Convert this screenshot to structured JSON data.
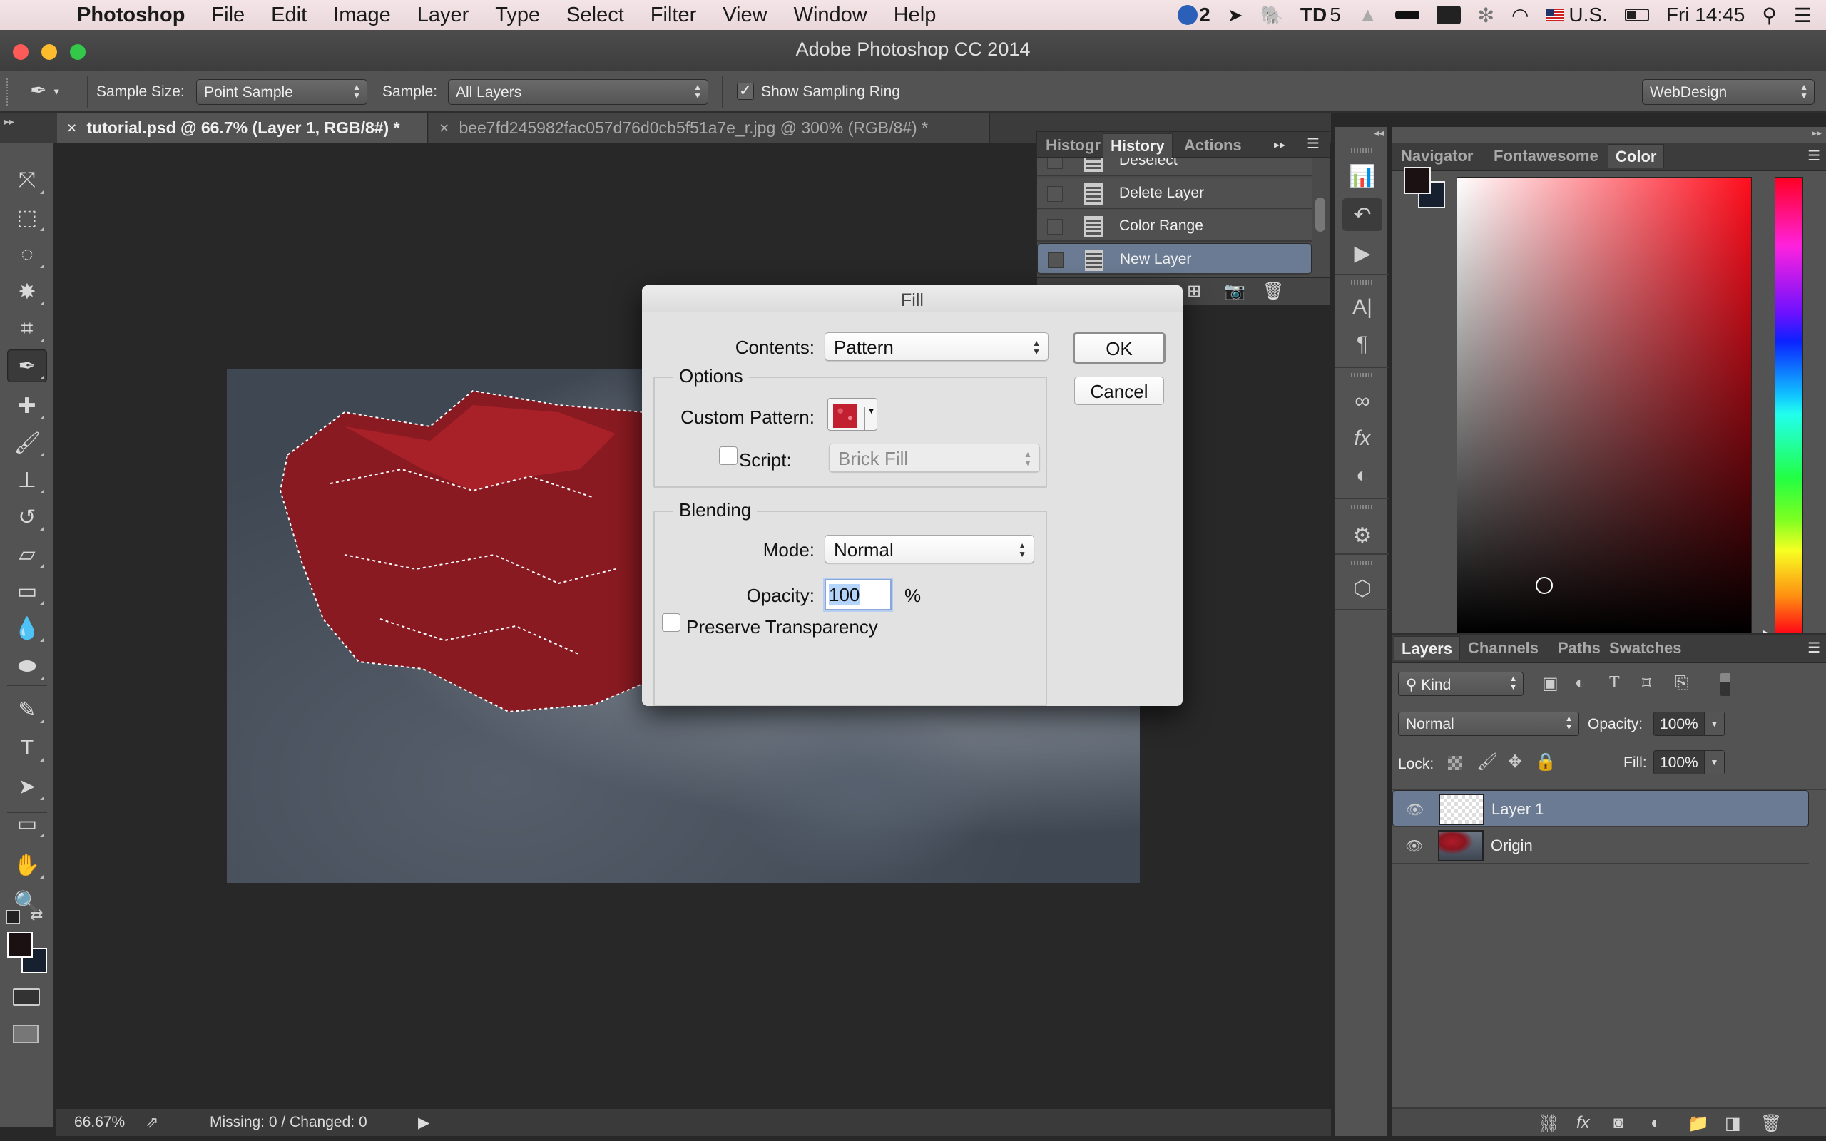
{
  "menubar": {
    "app_name": "Photoshop",
    "items": [
      "File",
      "Edit",
      "Image",
      "Layer",
      "Type",
      "Select",
      "Filter",
      "View",
      "Window",
      "Help"
    ],
    "status": {
      "cc_count": "2",
      "td_count": "5",
      "input_source": "U.S.",
      "clock": "Fri 14:45"
    }
  },
  "window": {
    "title": "Adobe Photoshop CC 2014"
  },
  "options_bar": {
    "sample_size_label": "Sample Size:",
    "sample_size_value": "Point Sample",
    "sample_label": "Sample:",
    "sample_value": "All Layers",
    "show_sampling_ring_label": "Show Sampling Ring",
    "show_sampling_ring_checked": true,
    "workspace": "WebDesign"
  },
  "doc_tabs": [
    {
      "label": "tutorial.psd @ 66.7% (Layer 1, RGB/8#) *",
      "active": true
    },
    {
      "label": "bee7fd245982fac057d76d0cb5f51a7e_r.jpg @ 300% (RGB/8#) *",
      "active": false
    }
  ],
  "toolbar": {
    "tools": [
      {
        "name": "move-tool",
        "glyph": "⤧"
      },
      {
        "name": "marquee-tool",
        "glyph": "⬚"
      },
      {
        "name": "lasso-tool",
        "glyph": "◌"
      },
      {
        "name": "magic-wand-tool",
        "glyph": "✸"
      },
      {
        "name": "crop-tool",
        "glyph": "⌗"
      },
      {
        "name": "eyedropper-tool",
        "glyph": "✒",
        "active": true
      },
      {
        "name": "healing-brush-tool",
        "glyph": "✚"
      },
      {
        "name": "brush-tool",
        "glyph": "🖌"
      },
      {
        "name": "clone-stamp-tool",
        "glyph": "⊥"
      },
      {
        "name": "history-brush-tool",
        "glyph": "↺"
      },
      {
        "name": "eraser-tool",
        "glyph": "▱"
      },
      {
        "name": "gradient-tool",
        "glyph": "▭"
      },
      {
        "name": "blur-tool",
        "glyph": "💧"
      },
      {
        "name": "sponge-tool",
        "glyph": "⬬"
      },
      {
        "name": "pen-tool",
        "glyph": "✎"
      },
      {
        "name": "type-tool",
        "glyph": "T"
      },
      {
        "name": "path-selection-tool",
        "glyph": "➤"
      },
      {
        "name": "rectangle-tool",
        "glyph": "▭"
      },
      {
        "name": "hand-tool",
        "glyph": "✋"
      },
      {
        "name": "zoom-tool",
        "glyph": "🔍"
      }
    ],
    "foreground_color": "#1b1012",
    "background_color": "#16202e"
  },
  "status_bar": {
    "zoom": "66.67%",
    "info": "Missing: 0 / Changed: 0"
  },
  "history_panel": {
    "tabs": [
      "Histogr",
      "History",
      "Actions"
    ],
    "active_tab": "History",
    "items": [
      {
        "label": "Deselect",
        "selected": false
      },
      {
        "label": "Delete Layer",
        "selected": false
      },
      {
        "label": "Color Range",
        "selected": false
      },
      {
        "label": "New Layer",
        "selected": true
      }
    ]
  },
  "color_panel": {
    "tabs": [
      "Navigator",
      "Fontawesome",
      "Color"
    ],
    "active_tab": "Color",
    "foreground": "#1b1012",
    "background": "#16202e",
    "hue_color": "#ff0d1c"
  },
  "layers_panel": {
    "tabs": [
      "Layers",
      "Channels",
      "Paths",
      "Swatches"
    ],
    "active_tab": "Layers",
    "filter_kind": "Kind",
    "blend_mode": "Normal",
    "opacity_label": "Opacity:",
    "opacity": "100%",
    "lock_label": "Lock:",
    "fill_label": "Fill:",
    "fill": "100%",
    "layers": [
      {
        "name": "Layer 1",
        "selected": true,
        "visible": true,
        "thumb": "transparent"
      },
      {
        "name": "Origin",
        "selected": false,
        "visible": true,
        "thumb": "image"
      }
    ]
  },
  "fill_dialog": {
    "title": "Fill",
    "contents_label": "Contents:",
    "contents_value": "Pattern",
    "ok_label": "OK",
    "cancel_label": "Cancel",
    "options_group": "Options",
    "custom_pattern_label": "Custom Pattern:",
    "script_label": "Script:",
    "script_checked": false,
    "script_value": "Brick Fill",
    "blending_group": "Blending",
    "mode_label": "Mode:",
    "mode_value": "Normal",
    "opacity_label": "Opacity:",
    "opacity_value": "100",
    "opacity_unit": "%",
    "preserve_transparency_label": "Preserve Transparency",
    "preserve_transparency_checked": false
  }
}
